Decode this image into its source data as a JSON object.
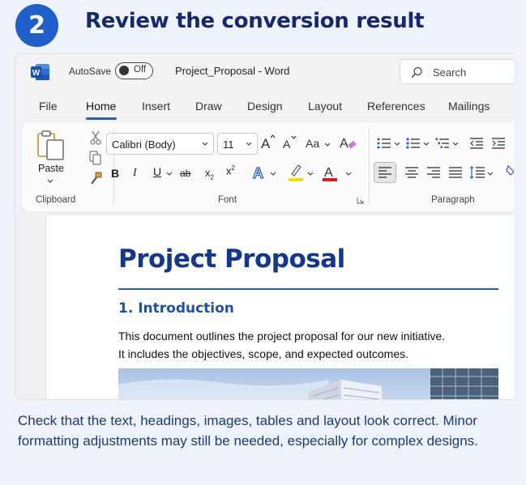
{
  "step": {
    "number": "2",
    "title": "Review the conversion result"
  },
  "titlebar": {
    "app_icon": "word-logo-icon",
    "autosave_label": "AutoSave",
    "autosave_state": "Off",
    "document_title": "Project_Proposal  -  Word",
    "search_placeholder": "Search"
  },
  "menu": {
    "items": [
      "File",
      "Home",
      "Insert",
      "Draw",
      "Design",
      "Layout",
      "References",
      "Mailings"
    ],
    "active": "Home"
  },
  "ribbon": {
    "clipboard": {
      "paste_label": "Paste",
      "group_label": "Clipboard"
    },
    "font": {
      "font_name": "Calibri (Body)",
      "font_size": "11",
      "group_label": "Font",
      "change_case": "Aa"
    },
    "paragraph": {
      "group_label": "Paragraph"
    },
    "colors": {
      "highlight": "#f2e000",
      "font_color": "#d81b1b",
      "accent": "#2b5fb3"
    }
  },
  "document": {
    "heading": "Project Proposal",
    "subheading": "1. Introduction",
    "body_lines": [
      "This document outlines the project proposal for our new initiative.",
      "It includes the objectives, scope, and expected outcomes."
    ]
  },
  "footer": {
    "text": "Check that the text, headings, images, tables and layout look correct. Minor formatting adjustments may still be needed, especially for complex designs."
  }
}
